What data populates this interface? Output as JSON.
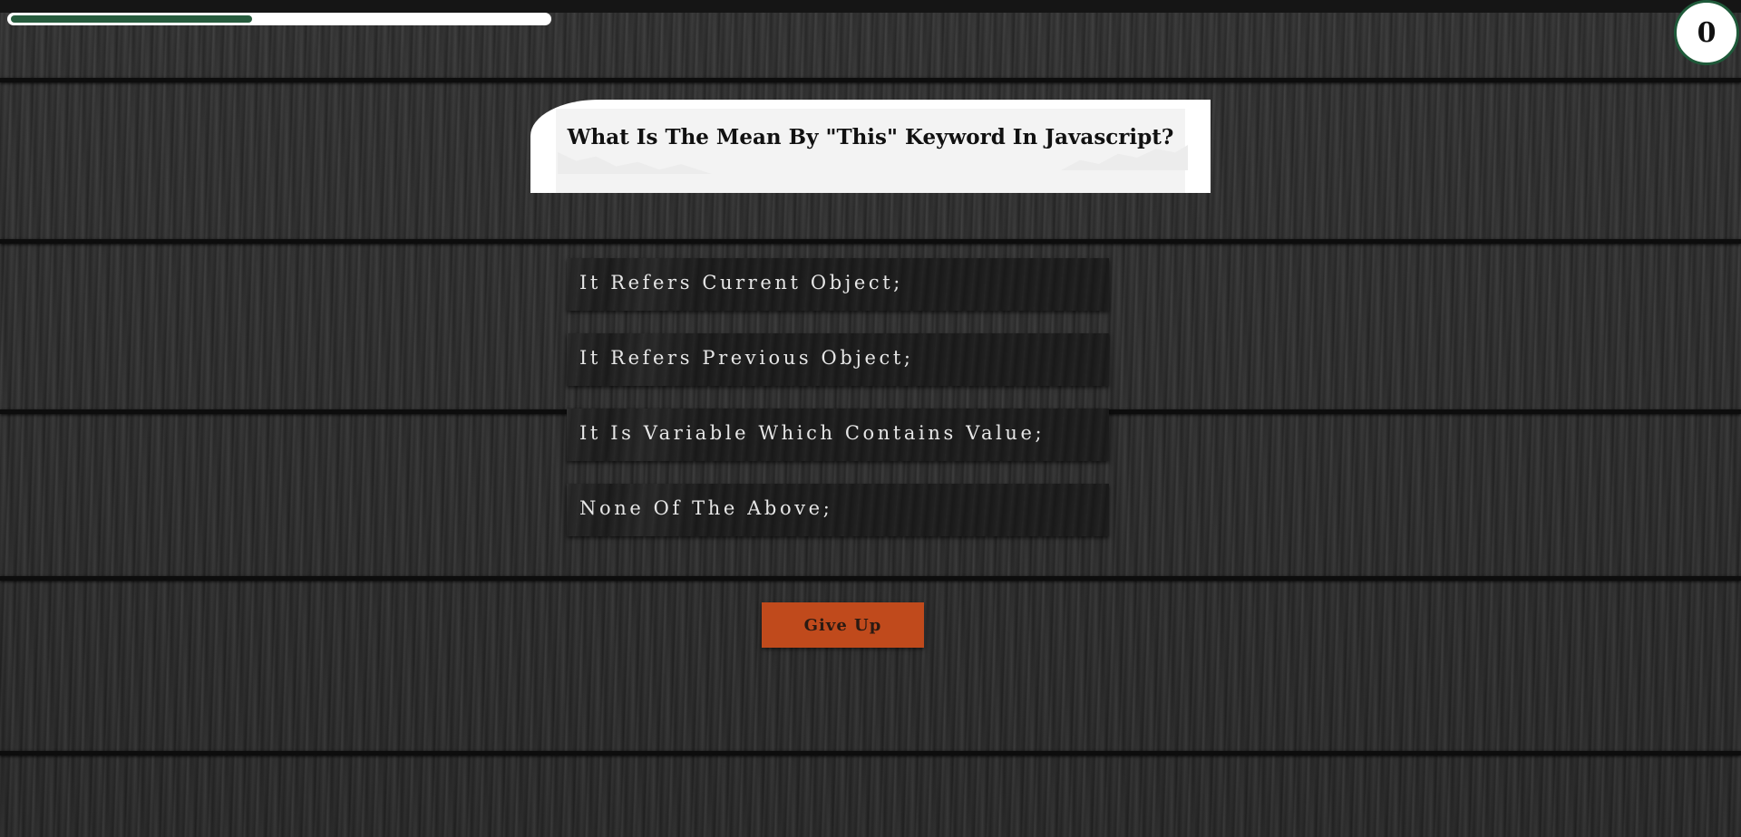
{
  "quiz": {
    "progress_fraction": 0.45,
    "score": "0",
    "question": "What Is The Mean By \"This\" Keyword In Javascript?",
    "answers": [
      "It Refers Current Object;",
      "It Refers Previous Object;",
      "It Is Variable Which Contains Value;",
      "None Of The Above;"
    ],
    "give_up_label": "Give Up"
  },
  "colors": {
    "progress_fill": "#275c3e",
    "score_border": "#1f5a3a",
    "give_up_button": "#c04a1c",
    "answer_background": "#1d1d1d"
  }
}
